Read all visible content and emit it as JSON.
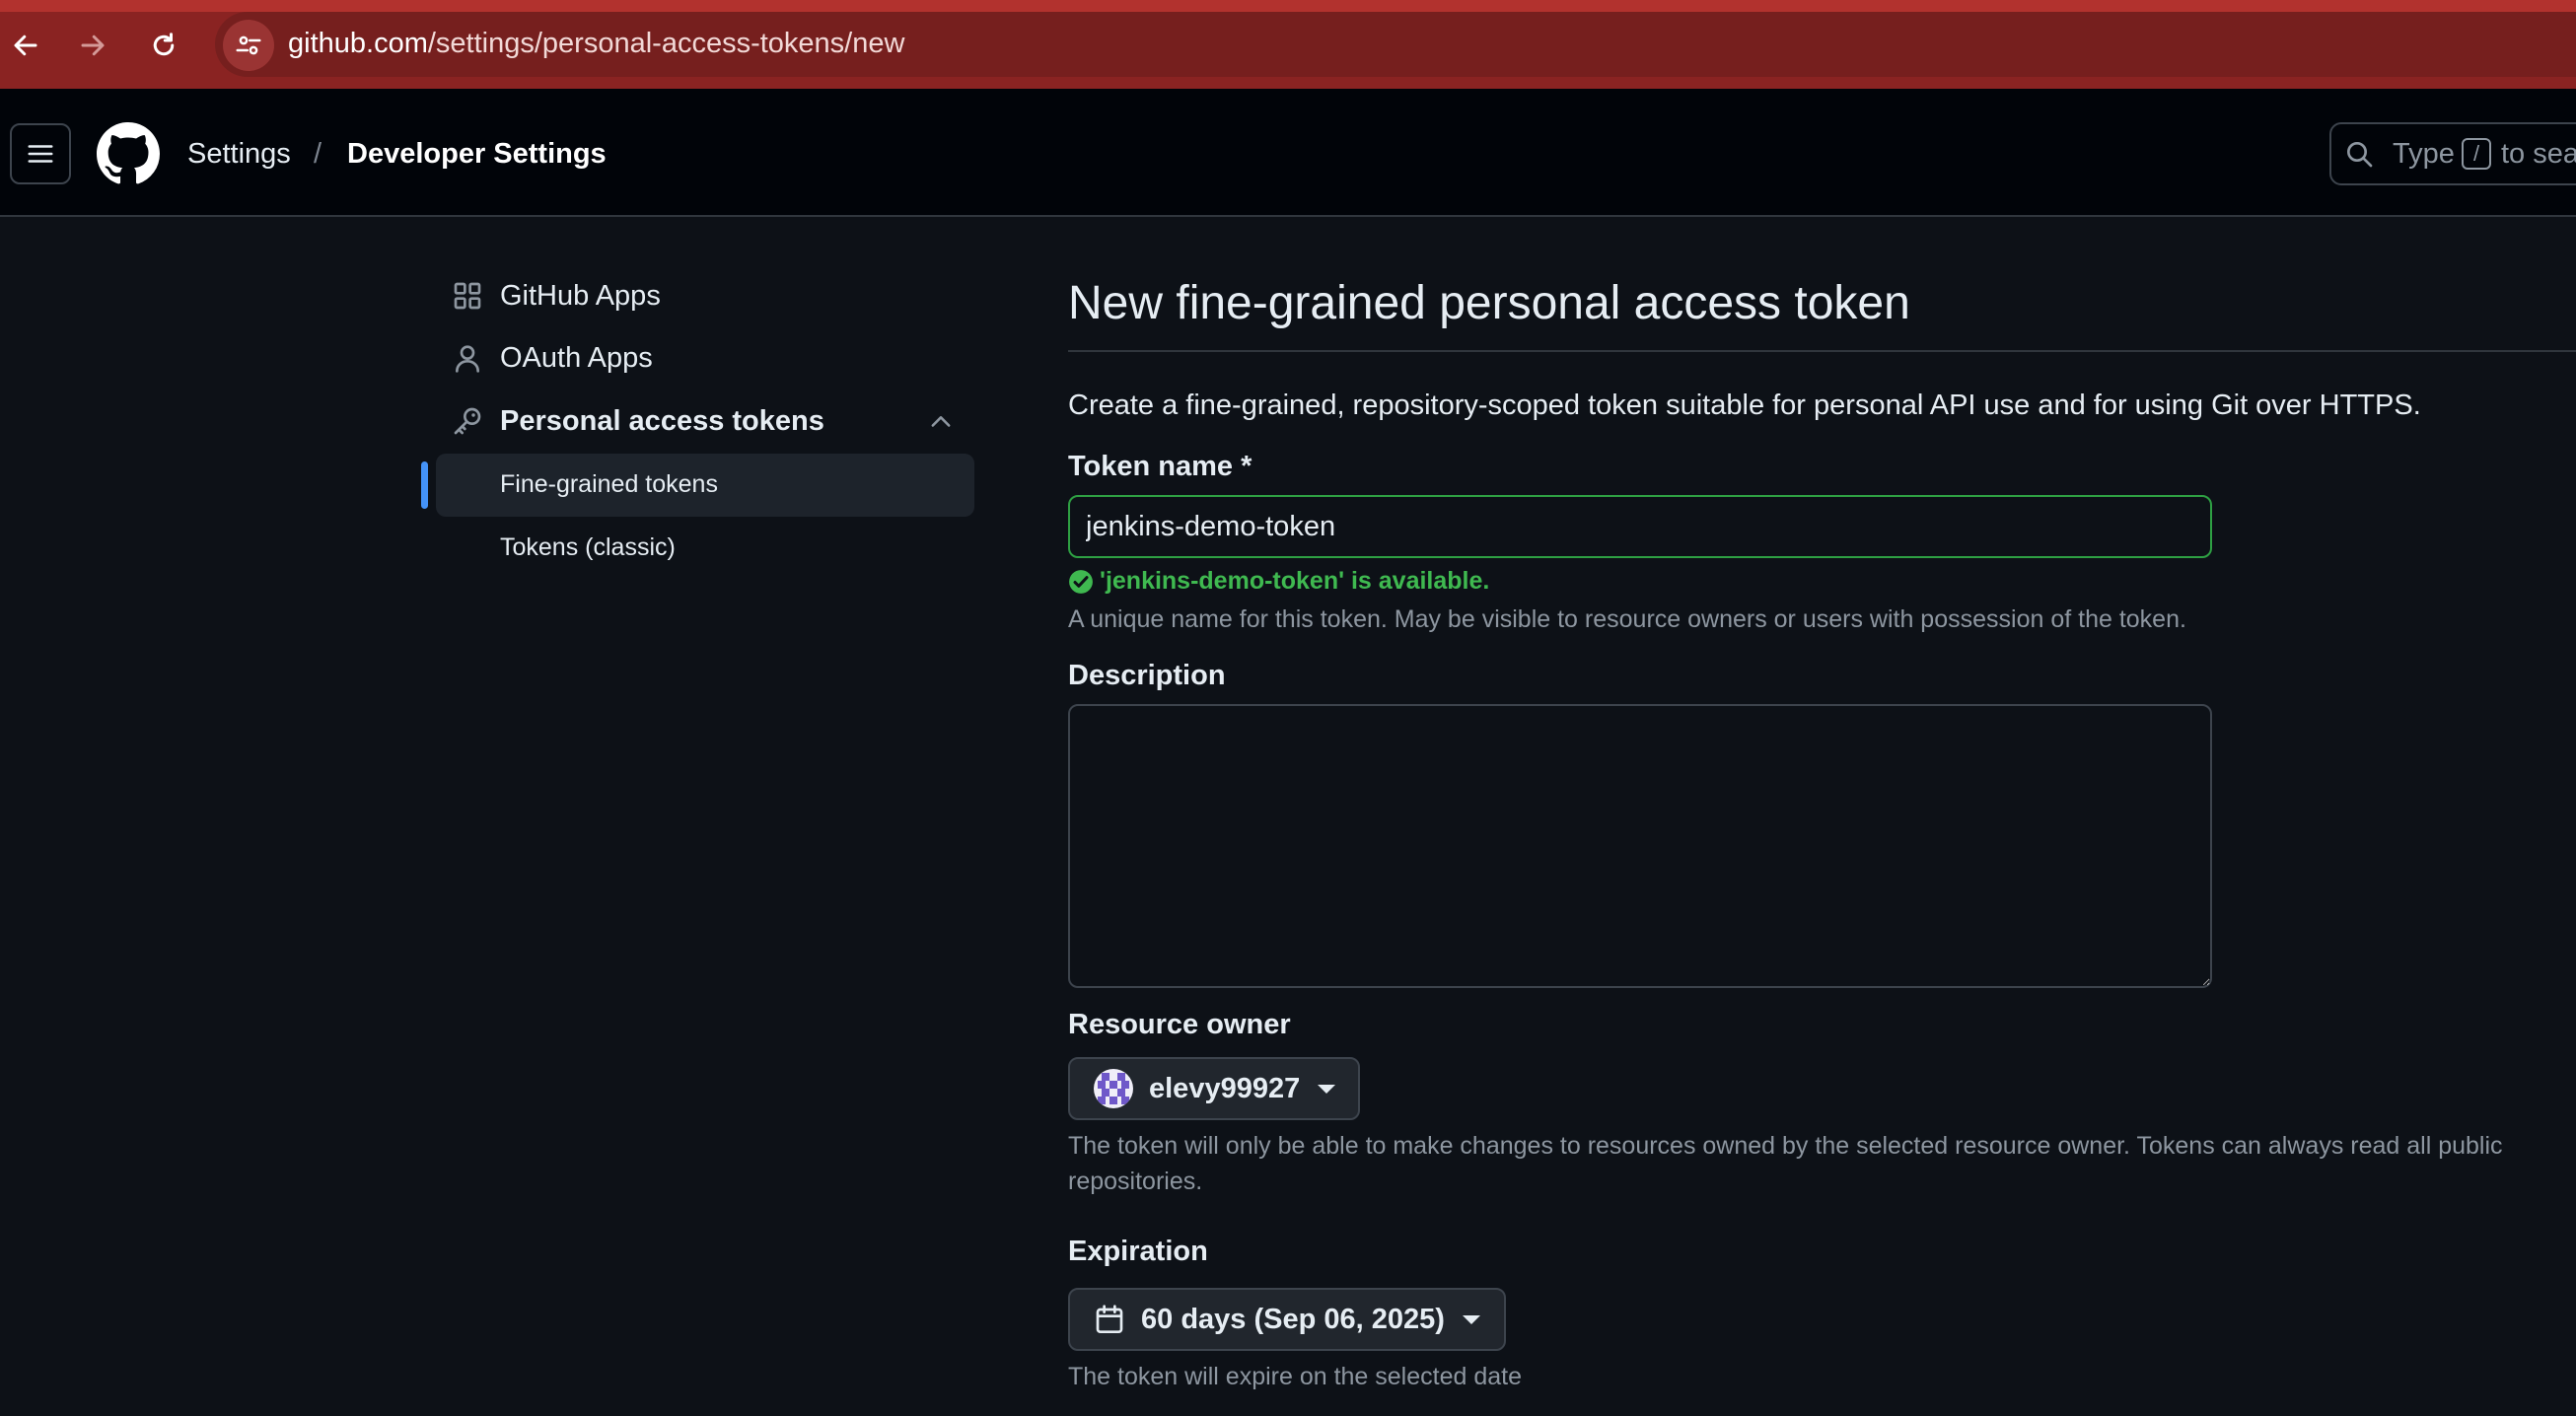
{
  "browser": {
    "url_host": "github.com",
    "url_path": "/settings/personal-access-tokens/new"
  },
  "header": {
    "breadcrumb": [
      "Settings",
      "/",
      "Developer Settings"
    ],
    "search_prefix": "Type",
    "search_key": "/",
    "search_suffix": "to sea"
  },
  "sidebar": {
    "items": [
      {
        "label": "GitHub Apps",
        "icon": "apps-icon"
      },
      {
        "label": "OAuth Apps",
        "icon": "person-icon"
      },
      {
        "label": "Personal access tokens",
        "icon": "key-icon",
        "expanded": true
      }
    ],
    "subitems": [
      {
        "label": "Fine-grained tokens",
        "active": true
      },
      {
        "label": "Tokens (classic)",
        "active": false
      }
    ]
  },
  "main": {
    "title": "New fine-grained personal access token",
    "intro": "Create a fine-grained, repository-scoped token suitable for personal API use and for using Git over HTTPS.",
    "token_name": {
      "label": "Token name *",
      "value": "jenkins-demo-token",
      "availability": "'jenkins-demo-token' is available.",
      "note": "A unique name for this token. May be visible to resource owners or users with possession of the token."
    },
    "description": {
      "label": "Description",
      "value": ""
    },
    "resource_owner": {
      "label": "Resource owner",
      "value": "elevy99927",
      "note_line1": "The token will only be able to make changes to resources owned by the selected resource owner. Tokens can always read all public",
      "note_line2": "repositories."
    },
    "expiration": {
      "label": "Expiration",
      "value": "60 days (Sep 06, 2025)",
      "note": "The token will expire on the selected date"
    }
  },
  "colors": {
    "accent": "#4493f8",
    "success": "#3fb950",
    "browser_chrome": "#8a2322",
    "background": "#0d1117"
  }
}
